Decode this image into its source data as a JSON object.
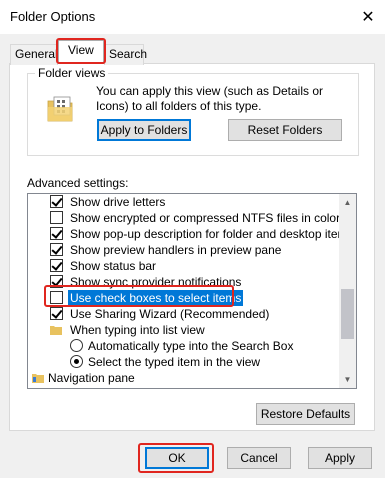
{
  "window": {
    "title": "Folder Options",
    "close_glyph": "✕"
  },
  "tabs": [
    {
      "label": "General",
      "active": false
    },
    {
      "label": "View",
      "active": true
    },
    {
      "label": "Search",
      "active": false
    }
  ],
  "folder_views": {
    "legend": "Folder views",
    "description": "You can apply this view (such as Details or Icons) to all folders of this type.",
    "apply_button": "Apply to Folders",
    "reset_button": "Reset Folders"
  },
  "advanced": {
    "label": "Advanced settings:",
    "items": [
      {
        "kind": "checkbox",
        "checked": true,
        "label": "Show drive letters"
      },
      {
        "kind": "checkbox",
        "checked": false,
        "label": "Show encrypted or compressed NTFS files in color"
      },
      {
        "kind": "checkbox",
        "checked": true,
        "label": "Show pop-up description for folder and desktop items"
      },
      {
        "kind": "checkbox",
        "checked": true,
        "label": "Show preview handlers in preview pane"
      },
      {
        "kind": "checkbox",
        "checked": true,
        "label": "Show status bar"
      },
      {
        "kind": "checkbox",
        "checked": true,
        "label": "Show sync provider notifications"
      },
      {
        "kind": "checkbox",
        "checked": false,
        "label": "Use check boxes to select items",
        "selected": true
      },
      {
        "kind": "checkbox",
        "checked": true,
        "label": "Use Sharing Wizard (Recommended)"
      },
      {
        "kind": "folder",
        "label": "When typing into list view"
      },
      {
        "kind": "radio",
        "checked": false,
        "label": "Automatically type into the Search Box"
      },
      {
        "kind": "radio",
        "checked": true,
        "label": "Select the typed item in the view"
      },
      {
        "kind": "nav",
        "label": "Navigation pane"
      }
    ],
    "restore_button": "Restore Defaults"
  },
  "footer": {
    "ok": "OK",
    "cancel": "Cancel",
    "apply": "Apply"
  },
  "colors": {
    "selection": "#0078d7",
    "highlight": "#e0261f"
  }
}
